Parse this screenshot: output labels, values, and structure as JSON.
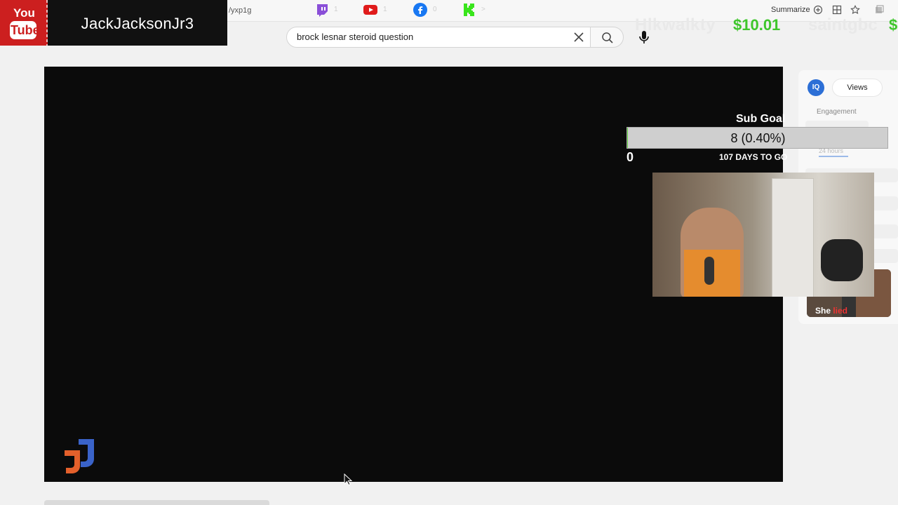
{
  "browser": {
    "url_fragment": "/yxp1g",
    "summarize_label": "Summarize",
    "social_counts": {
      "twitch": "1",
      "youtube": "1",
      "facebook": "0",
      "kick": ">"
    }
  },
  "channel": {
    "youtube_logo_you": "You",
    "youtube_logo_tube": "Tube",
    "name": "JackJacksonJr3"
  },
  "search": {
    "value": "brock lesnar steroid question"
  },
  "donations": [
    {
      "name": "Hlkwalkty",
      "amount": "$10.01"
    },
    {
      "name": "saintgbc",
      "amount": "$"
    }
  ],
  "sub_goal": {
    "label": "Sub Goal",
    "value_text": "8 (0.40%)",
    "progress_percent": 0.4,
    "min_label": "0",
    "days_text": "107 DAYS TO GO"
  },
  "sidebar": {
    "badge": "IQ",
    "views_tab": "Views",
    "engagement_label": "Engagement",
    "range_label": "24 hours",
    "thumbnail_text_prefix": "She ",
    "thumbnail_text_highlight": "lied"
  },
  "colors": {
    "accent_green": "#3ec62b",
    "youtube_red": "#cc1f1f",
    "iq_blue": "#2c6fd6"
  }
}
